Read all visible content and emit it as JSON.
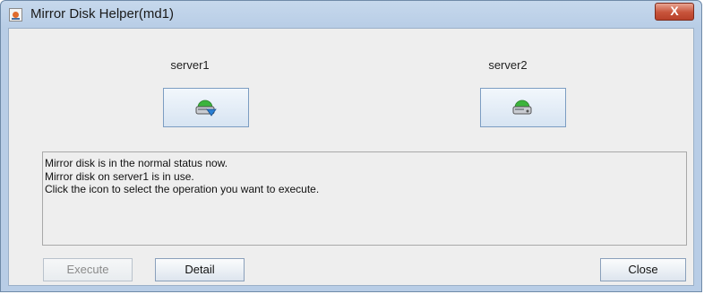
{
  "window": {
    "title": "Mirror Disk Helper(md1)",
    "close_glyph": "X"
  },
  "servers": [
    {
      "label": "server1",
      "icon": "mirror-disk-active-icon"
    },
    {
      "label": "server2",
      "icon": "mirror-disk-icon"
    }
  ],
  "messages": [
    "Mirror disk is in the normal status now.",
    "Mirror disk on server1 is in use.",
    "Click the icon to select the operation you want to execute."
  ],
  "buttons": {
    "execute": "Execute",
    "detail": "Detail",
    "close": "Close"
  },
  "colors": {
    "disk_green": "#3cb43c",
    "active_arrow": "#2a7fd4",
    "title_bg": "#b8cde6"
  }
}
